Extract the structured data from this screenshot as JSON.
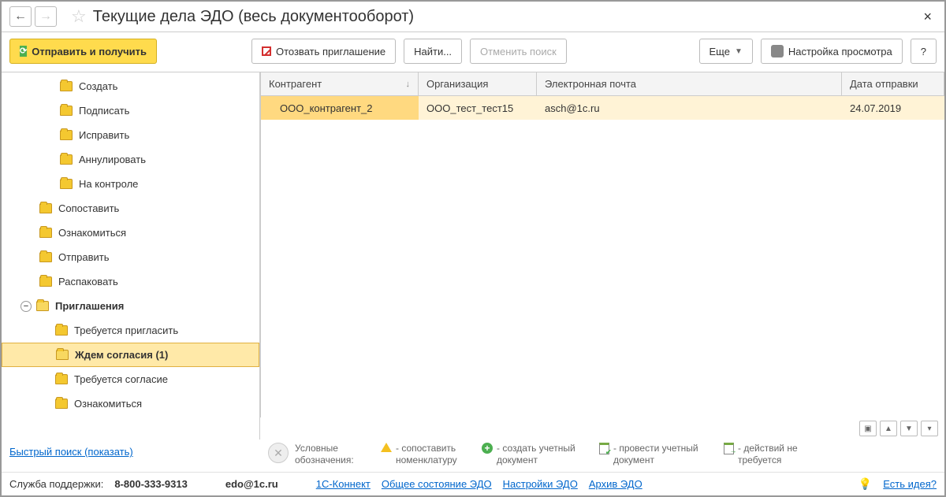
{
  "title": "Текущие дела ЭДО (весь документооборот)",
  "toolbar": {
    "send_receive": "Отправить и получить",
    "revoke_invite": "Отозвать приглашение",
    "find": "Найти...",
    "cancel_search": "Отменить поиск",
    "more": "Еще",
    "view_settings": "Настройка просмотра",
    "help": "?"
  },
  "tree": {
    "create": "Создать",
    "sign": "Подписать",
    "fix": "Исправить",
    "annul": "Аннулировать",
    "on_control": "На контроле",
    "match": "Сопоставить",
    "review": "Ознакомиться",
    "send": "Отправить",
    "unpack": "Распаковать",
    "invitations": "Приглашения",
    "need_invite": "Требуется пригласить",
    "wait_consent": "Ждем согласия (1)",
    "need_consent": "Требуется согласие",
    "review2": "Ознакомиться"
  },
  "table": {
    "headers": {
      "counterparty": "Контрагент",
      "org": "Организация",
      "email": "Электронная почта",
      "sent_date": "Дата отправки"
    },
    "row": {
      "counterparty": "ООО_контрагент_2",
      "org": "ООО_тест_тест15",
      "email": "asch@1c.ru",
      "sent_date": "24.07.2019"
    }
  },
  "quick_search": "Быстрый поиск (показать)",
  "legend": {
    "label": "Условные обозначения:",
    "match": "- сопоставить номенклатуру",
    "create_doc": "- создать учетный документ",
    "post_doc": "- провести учетный документ",
    "no_action": "- действий не требуется"
  },
  "footer": {
    "support_label": "Служба поддержки:",
    "phone": "8-800-333-9313",
    "email": "edo@1c.ru",
    "connect": "1С-Коннект",
    "status": "Общее состояние ЭДО",
    "settings": "Настройки ЭДО",
    "archive": "Архив ЭДО",
    "idea": "Есть идея?"
  }
}
